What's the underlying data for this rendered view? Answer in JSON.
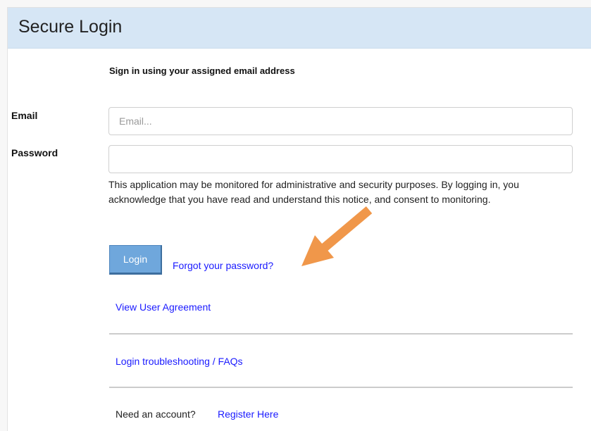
{
  "header": {
    "title": "Secure Login"
  },
  "form": {
    "instruction": "Sign in using your assigned email address",
    "email_label": "Email",
    "email_placeholder": "Email...",
    "email_value": "",
    "password_label": "Password",
    "password_value": "",
    "notice": "This application may be monitored for administrative and security purposes. By logging in, you acknowledge that you have read and understand this notice, and consent to monitoring.",
    "login_label": "Login",
    "forgot_label": "Forgot your password?",
    "agreement_label": "View User Agreement",
    "troubleshooting_label": "Login troubleshooting / FAQs",
    "need_account_text": "Need an account?",
    "register_label": "Register Here"
  },
  "annotation": {
    "arrow_color": "#f0974a",
    "icon": "arrow-icon"
  },
  "colors": {
    "header_bg": "#d6e6f5",
    "button_bg": "#6fa7dc",
    "link": "#1a1aff"
  }
}
